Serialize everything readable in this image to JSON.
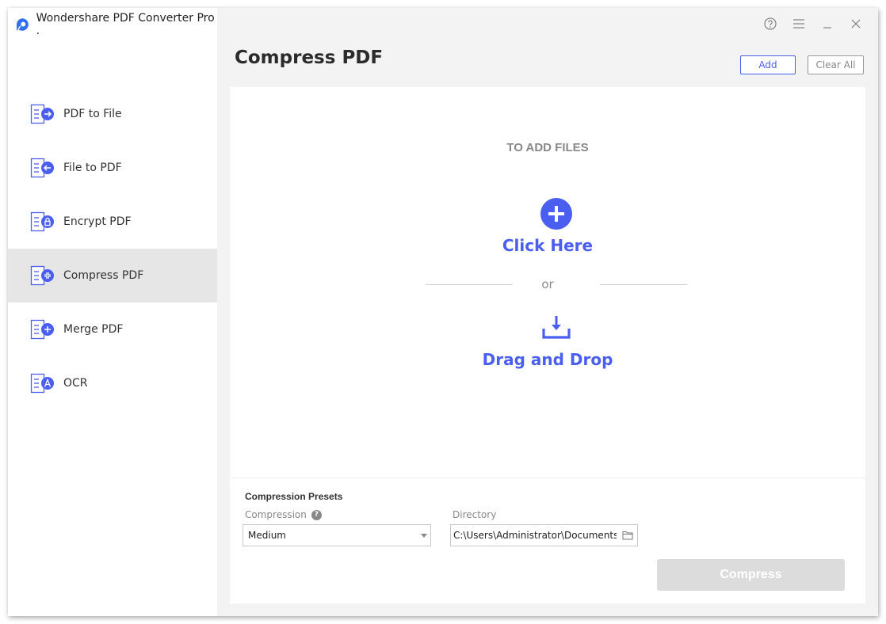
{
  "app": {
    "title": "Wondershare PDF Converter Pro .",
    "accent_color": "#4a5ef0"
  },
  "window_controls": [
    {
      "name": "help",
      "icon": "help-circle-icon",
      "glyph": "?"
    },
    {
      "name": "menu",
      "icon": "hamburger-menu-icon",
      "glyph": "≡"
    },
    {
      "name": "minimize",
      "icon": "minimize-icon",
      "glyph": "_"
    },
    {
      "name": "close",
      "icon": "close-icon",
      "glyph": "✕"
    }
  ],
  "sidebar": {
    "items": [
      {
        "label": "PDF to File",
        "icon": "arrow-right-icon",
        "active": false
      },
      {
        "label": "File to PDF",
        "icon": "arrow-left-icon",
        "active": false
      },
      {
        "label": "Encrypt PDF",
        "icon": "lock-icon",
        "active": false
      },
      {
        "label": "Compress PDF",
        "icon": "compress-icon",
        "active": true
      },
      {
        "label": "Merge PDF",
        "icon": "plus-icon",
        "active": false
      },
      {
        "label": "OCR",
        "icon": "ocr-a-icon",
        "active": false
      }
    ]
  },
  "header": {
    "title": "Compress PDF",
    "add_label": "Add",
    "clear_all_label": "Clear All"
  },
  "dropzone": {
    "heading": "TO ADD FILES",
    "click_here": "Click Here",
    "or": "or",
    "drag_drop": "Drag and Drop"
  },
  "settings": {
    "presets_title": "Compression Presets",
    "compression_label": "Compression",
    "compression_help": "?",
    "compression_value": "Medium",
    "directory_label": "Directory",
    "directory_value": "C:\\Users\\Administrator\\Documents\\Wondershare"
  },
  "actions": {
    "compress_label": "Compress"
  }
}
